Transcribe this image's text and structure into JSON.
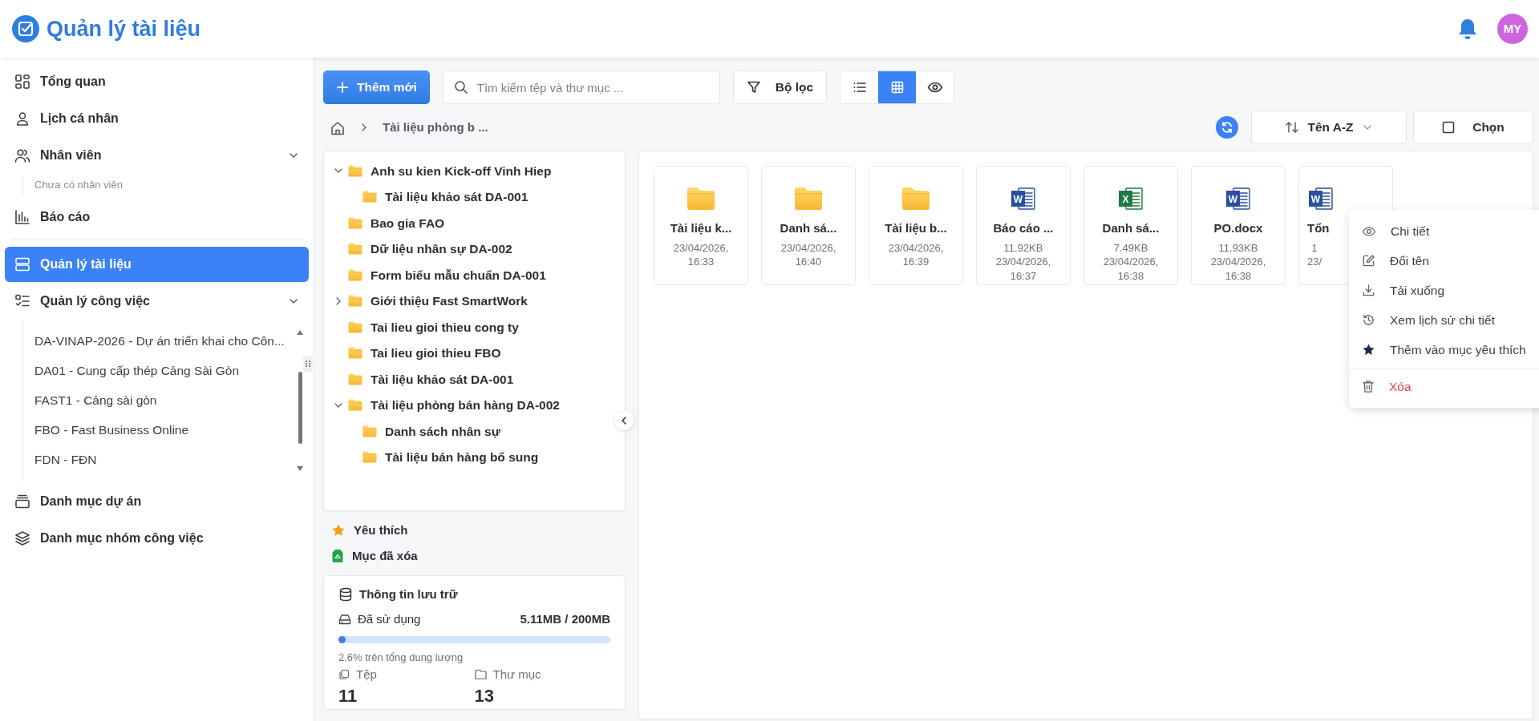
{
  "header": {
    "title": "Quản lý tài liệu",
    "avatar_initials": "MY"
  },
  "sidebar": {
    "items": [
      {
        "label": "Tổng quan",
        "selected": false
      },
      {
        "label": "Lịch cá nhân",
        "selected": false
      },
      {
        "label": "Nhân viên",
        "selected": false,
        "expanded": true,
        "empty_note": "Chưa có nhân viên"
      },
      {
        "label": "Báo cáo",
        "selected": false
      },
      {
        "label": "Quản lý tài liệu",
        "selected": true
      },
      {
        "label": "Quản lý công việc",
        "selected": false,
        "expanded": true,
        "children": [
          {
            "label": "DA-VINAP-2026 - Dự án triển khai cho Côn..."
          },
          {
            "label": "DA01 - Cung cấp thép Cảng Sài Gòn"
          },
          {
            "label": "FAST1 - Cảng sài gòn"
          },
          {
            "label": "FBO - Fast Business Online"
          },
          {
            "label": "FDN - FĐN"
          }
        ]
      },
      {
        "label": "Danh mục dự án",
        "selected": false
      },
      {
        "label": "Danh mục nhóm công việc",
        "selected": false
      }
    ]
  },
  "toolbar": {
    "add_button": "Thêm mới",
    "search": {
      "placeholder": "Tìm kiếm tệp và thư mục ..."
    },
    "filter_button": "Bộ lọc",
    "view_modes": [
      {
        "selected": false
      },
      {
        "selected": true
      },
      {
        "selected": false
      }
    ]
  },
  "breadcrumb": [
    "Tài liệu phòng b ..."
  ],
  "sort": {
    "label": "Tên A-Z"
  },
  "select_button": "Chọn",
  "tree": [
    {
      "label": "Anh su kien Kick-off Vinh Hiep",
      "expanded": true,
      "children": [
        {
          "label": "Tài liệu khảo sát DA-001"
        }
      ]
    },
    {
      "label": "Bao gia FAO"
    },
    {
      "label": "Dữ liệu nhân sự DA-002"
    },
    {
      "label": "Form biểu mẫu chuẩn DA-001"
    },
    {
      "label": "Giới thiệu Fast SmartWork",
      "expanded": false
    },
    {
      "label": "Tai lieu gioi thieu cong ty"
    },
    {
      "label": "Tai lieu gioi thieu FBO"
    },
    {
      "label": "Tài liệu khảo sát DA-001"
    },
    {
      "label": "Tài liệu phòng bán hàng DA-002",
      "expanded": true,
      "children": [
        {
          "label": "Danh sách nhân sự"
        },
        {
          "label": "Tài liệu bán hàng bổ sung"
        }
      ]
    }
  ],
  "quick_links": [
    {
      "kind": "favorites",
      "label": "Yêu thích"
    },
    {
      "kind": "trash",
      "label": "Mục đã xóa"
    }
  ],
  "storage": {
    "title": "Thông tin lưu trữ",
    "used_label": "Đã sử dụng",
    "used_value": "5.11MB / 200MB",
    "level": 0.026,
    "percent_text": "2.6% trên tổng dung lượng",
    "files_label": "Tệp",
    "folders_label": "Thư mục",
    "files_count": "11",
    "folders_count": "13"
  },
  "files": [
    {
      "kind": "folder",
      "name": "Tài liệu k...",
      "date": "23/04/2026,",
      "time": "16:33"
    },
    {
      "kind": "folder",
      "name": "Danh sá...",
      "date": "23/04/2026,",
      "time": "16:40"
    },
    {
      "kind": "folder",
      "name": "Tài liệu b...",
      "date": "23/04/2026,",
      "time": "16:39"
    },
    {
      "kind": "word",
      "icon_letter": "W",
      "name": "Báo cáo ...",
      "size": "11.92KB",
      "date": "23/04/2026,",
      "time": "16:37"
    },
    {
      "kind": "excel",
      "icon_letter": "X",
      "name": "Danh sá...",
      "size": "7.49KB",
      "date": "23/04/2026,",
      "time": "16:38"
    },
    {
      "kind": "word",
      "icon_letter": "W",
      "name": "PO.docx",
      "size": "11.93KB",
      "date": "23/04/2026,",
      "time": "16:38"
    },
    {
      "kind": "word",
      "icon_letter": "W",
      "name": "Tổn",
      "size": "1",
      "date": "23/"
    }
  ],
  "context_menu": [
    {
      "kind": "normal",
      "label": "Chi tiết"
    },
    {
      "kind": "normal",
      "label": "Đổi tên"
    },
    {
      "kind": "normal",
      "label": "Tải xuống"
    },
    {
      "kind": "normal",
      "label": "Xem lịch sử chi tiết"
    },
    {
      "kind": "normal",
      "label": "Thêm vào mục yêu thích"
    },
    {
      "kind": "danger",
      "label": "Xóa"
    }
  ]
}
